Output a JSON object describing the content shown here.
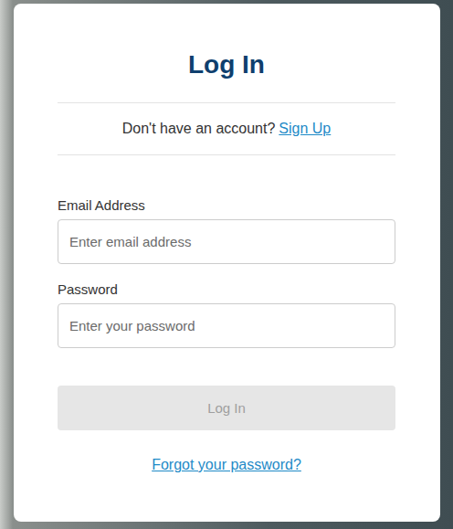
{
  "form": {
    "title": "Log In",
    "signup_prompt": "Don't have an account?",
    "signup_link": "Sign Up",
    "fields": [
      {
        "label": "Email Address",
        "placeholder": "Enter email address",
        "type": "email"
      },
      {
        "label": "Password",
        "placeholder": "Enter your password",
        "type": "password"
      }
    ],
    "submit": {
      "label": "Log In",
      "disabled": true
    },
    "forgot_link": "Forgot your password?"
  }
}
